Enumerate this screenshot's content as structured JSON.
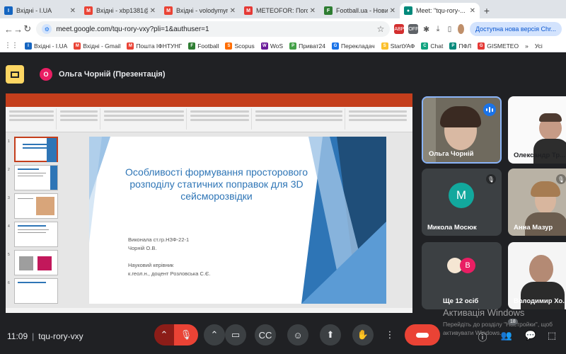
{
  "tabs": [
    {
      "title": "Вхідні - I.UA",
      "fav": "I",
      "color": "#1565c0"
    },
    {
      "title": "Вхідні - xbp1381@...",
      "fav": "M",
      "color": "#ea4335"
    },
    {
      "title": "Вхідні - volodymyr...",
      "fav": "M",
      "color": "#ea4335"
    },
    {
      "title": "METEOFOR: Погода...",
      "fav": "M",
      "color": "#e53935"
    },
    {
      "title": "Football.ua - Нови...",
      "fav": "F",
      "color": "#2e7d32"
    },
    {
      "title": "Meet: \"tqu-rory-...",
      "fav": "●",
      "color": "#00897b"
    }
  ],
  "address": {
    "url": "meet.google.com/tqu-rory-vxy?pli=1&authuser=1",
    "update_label": "Доступна нова версія Chr..."
  },
  "bookmarks": [
    {
      "label": "Вхідні - I.UA",
      "color": "#1565c0",
      "ic": "I"
    },
    {
      "label": "Вхідні - Gmail",
      "color": "#ea4335",
      "ic": "M"
    },
    {
      "label": "Пошта ІФНТУНГ",
      "color": "#ea4335",
      "ic": "M"
    },
    {
      "label": "Football",
      "color": "#2e7d32",
      "ic": "F"
    },
    {
      "label": "Scopus",
      "color": "#ff6d00",
      "ic": "S"
    },
    {
      "label": "WoS",
      "color": "#6a1b9a",
      "ic": "W"
    },
    {
      "label": "Приват24",
      "color": "#43a047",
      "ic": "P"
    },
    {
      "label": "Перекладач",
      "color": "#1a73e8",
      "ic": "G"
    },
    {
      "label": "StartУАФ",
      "color": "#fbc02d",
      "ic": "S"
    },
    {
      "label": "Chat",
      "color": "#10a37f",
      "ic": "C"
    },
    {
      "label": "ПФЛ",
      "color": "#00897b",
      "ic": "P"
    },
    {
      "label": "GISMETEO",
      "color": "#e53935",
      "ic": "G"
    },
    {
      "label": "»",
      "color": "#ffffff",
      "ic": ""
    },
    {
      "label": "Усі",
      "color": "#fbc02d",
      "ic": ""
    }
  ],
  "meet": {
    "presenter": "Ольга Чорній (Презентація)",
    "presenter_initial": "О",
    "meeting_code": "tqu-rory-vxy",
    "time": "11:09",
    "participants_count": "18",
    "watermark_title": "Активація Windows",
    "watermark_text": "Перейдіть до розділу \"Настройки\", щоб активувати Windows."
  },
  "slide": {
    "title": "Особливості формування просторового розподілу статичних поправок для 3D сейсморозвідки",
    "lines": [
      "Виконала ст.гр.НЗФ-22-1",
      "Чорній О.В.",
      "",
      "Науковий керівник",
      "к.геол.н., доцент Розловська С.Є."
    ]
  },
  "participants": [
    {
      "name": "Ольга Чорній",
      "type": "video"
    },
    {
      "name": "Олександр Тр...",
      "type": "video"
    },
    {
      "name": "Микола Мосюк",
      "type": "avatar",
      "initial": "М"
    },
    {
      "name": "Анна Мазур",
      "type": "video"
    },
    {
      "name": "Ще 12 осіб",
      "type": "group",
      "initial": "В"
    },
    {
      "name": "Володимир Хо...",
      "type": "video"
    }
  ]
}
